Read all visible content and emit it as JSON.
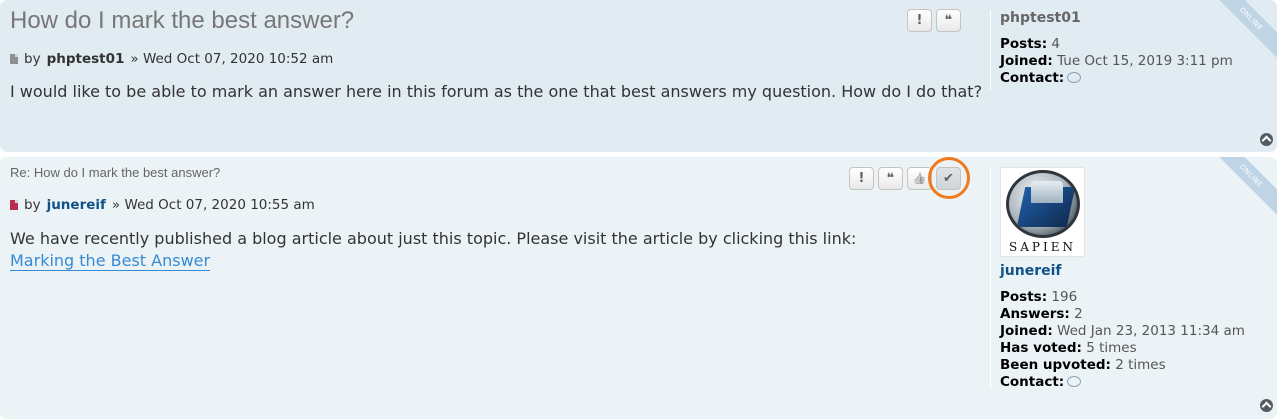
{
  "post1": {
    "title": "How do I mark the best answer?",
    "by": "by",
    "author": "phptest01",
    "timestamp": "» Wed Oct 07, 2020 10:52 am",
    "content": "I would like to be able to mark an answer here in this forum as the one that best answers my question. How do I do that?",
    "ribbon": "Online",
    "buttons": {
      "report": "!",
      "quote": "❝"
    },
    "profile": {
      "username": "phptest01",
      "posts_label": "Posts:",
      "posts_value": "4",
      "joined_label": "Joined:",
      "joined_value": "Tue Oct 15, 2019 3:11 pm",
      "contact_label": "Contact:"
    }
  },
  "post2": {
    "title": "Re: How do I mark the best answer?",
    "by": "by",
    "author": "junereif",
    "timestamp": "» Wed Oct 07, 2020 10:55 am",
    "content": "We have recently published a blog article about just this topic. Please visit the article by clicking this link:",
    "link_text": "Marking the Best Answer",
    "ribbon": "Online",
    "buttons": {
      "report": "!",
      "quote": "❝",
      "like": "👍",
      "accept": "✔"
    },
    "avatar_text": "SAPIEN",
    "profile": {
      "username": "junereif",
      "posts_label": "Posts:",
      "posts_value": "196",
      "answers_label": "Answers:",
      "answers_value": "2",
      "joined_label": "Joined:",
      "joined_value": "Wed Jan 23, 2013 11:34 am",
      "voted_label": "Has voted:",
      "voted_value": "5 times",
      "upvoted_label": "Been upvoted:",
      "upvoted_value": "2 times",
      "contact_label": "Contact:"
    }
  },
  "colors": {
    "accent": "#105289",
    "link": "#368ad2",
    "highlight": "#f07a1c",
    "unread_icon": "#bc2a4d"
  }
}
